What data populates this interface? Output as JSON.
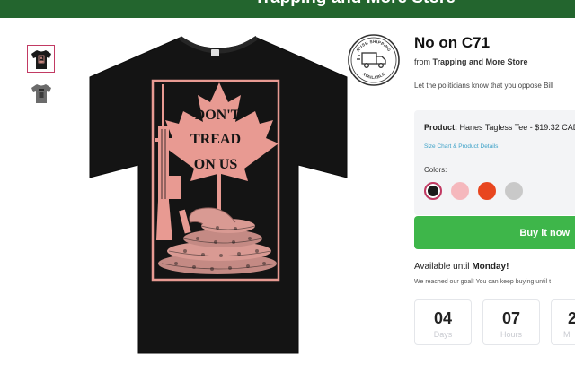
{
  "header": {
    "store_title": "Trapping and More Store"
  },
  "gallery": {
    "thumbnails": [
      {
        "color": "#1a1a1a",
        "selected": true
      },
      {
        "color": "#6b6b6b",
        "selected": false
      }
    ]
  },
  "shirt_art": {
    "text_lines": [
      "DON'T",
      "TREAD",
      "ON US"
    ],
    "ink_color": "#e89a92",
    "shirt_color": "#141414"
  },
  "badge": {
    "top_text": "RUSH SHIPPING",
    "bottom_text": "AVAILABLE"
  },
  "product": {
    "title": "No on C71",
    "from_label": "from",
    "store_name": "Trapping and More Store",
    "description": "Let the politicians know that you oppose Bill"
  },
  "options": {
    "product_label": "Product:",
    "product_value": "Hanes Tagless Tee - $19.32 CAD",
    "size_chart_link": "Size Chart & Product Details",
    "colors_label": "Colors:",
    "colors": [
      {
        "hex": "#1a1a1a",
        "selected": true
      },
      {
        "hex": "#f5b8bd",
        "selected": false
      },
      {
        "hex": "#e8461f",
        "selected": false
      },
      {
        "hex": "#c9c9c9",
        "selected": false
      }
    ]
  },
  "buy": {
    "label": "Buy it now",
    "color": "#3eb64a"
  },
  "availability": {
    "prefix": "Available until",
    "day": "Monday!",
    "goal_note": "We reached our goal! You can keep buying until t"
  },
  "countdown": [
    {
      "value": "04",
      "unit": "Days"
    },
    {
      "value": "07",
      "unit": "Hours"
    },
    {
      "value": "2",
      "unit": "Mi"
    }
  ]
}
